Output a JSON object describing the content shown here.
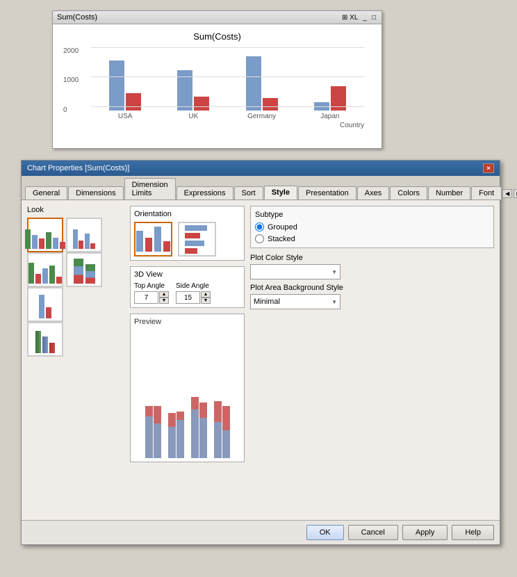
{
  "chartWindow": {
    "title": "Sum(Costs)",
    "chartTitle": "Sum(Costs)",
    "yAxisLabels": [
      "2000",
      "1000",
      "0"
    ],
    "xAxisLabels": [
      "USA",
      "UK",
      "Germany",
      "Japan"
    ],
    "xAxisTitle": "Country",
    "bars": [
      {
        "blue": 85,
        "red": 30
      },
      {
        "blue": 70,
        "red": 25
      },
      {
        "blue": 95,
        "red": 20
      },
      {
        "blue": 15,
        "red": 40
      }
    ]
  },
  "dialog": {
    "title": "Chart Properties [Sum(Costs)]",
    "tabs": [
      {
        "label": "General",
        "active": false
      },
      {
        "label": "Dimensions",
        "active": false
      },
      {
        "label": "Dimension Limits",
        "active": false
      },
      {
        "label": "Expressions",
        "active": false
      },
      {
        "label": "Sort",
        "active": false
      },
      {
        "label": "Style",
        "active": true
      },
      {
        "label": "Presentation",
        "active": false
      },
      {
        "label": "Axes",
        "active": false
      },
      {
        "label": "Colors",
        "active": false
      },
      {
        "label": "Number",
        "active": false
      },
      {
        "label": "Font",
        "active": false
      }
    ],
    "look": {
      "label": "Look"
    },
    "orientation": {
      "label": "Orientation"
    },
    "view3d": {
      "label": "3D View",
      "topAngle": {
        "label": "Top Angle",
        "value": "7"
      },
      "sideAngle": {
        "label": "Side Angle",
        "value": "15"
      }
    },
    "preview": {
      "label": "Preview"
    },
    "subtype": {
      "label": "Subtype",
      "options": [
        {
          "label": "Grouped",
          "selected": true
        },
        {
          "label": "Stacked",
          "selected": false
        }
      ]
    },
    "plotColorStyle": {
      "label": "Plot Color Style",
      "value": ""
    },
    "plotAreaBackground": {
      "label": "Plot Area Background Style",
      "value": "Minimal"
    }
  },
  "footer": {
    "ok": "OK",
    "cancel": "Cancel",
    "apply": "Apply",
    "help": "Help"
  }
}
